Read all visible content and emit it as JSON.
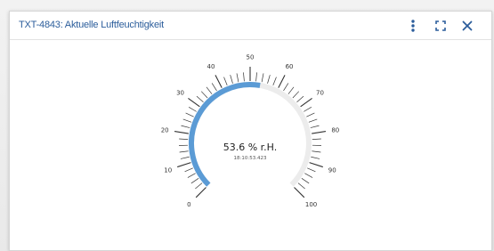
{
  "widget": {
    "title": "TXT-4843: Aktuelle Luftfeuchtigkeit",
    "buttons": {
      "menu_icon": "vertical-dots-icon",
      "fullscreen_icon": "fullscreen-icon",
      "close_icon": "close-icon"
    }
  },
  "gauge": {
    "min": 0,
    "max": 100,
    "value": 53.6,
    "value_text": "53.6 % r.H.",
    "timestamp": "18:10:53.423",
    "tick_labels": [
      "0",
      "10",
      "20",
      "30",
      "40",
      "50",
      "60",
      "70",
      "80",
      "90",
      "100"
    ],
    "colors": {
      "accent": "#5b9bd5",
      "track": "#ececec",
      "ticks": "#333333",
      "title": "#2b5d9b"
    }
  }
}
